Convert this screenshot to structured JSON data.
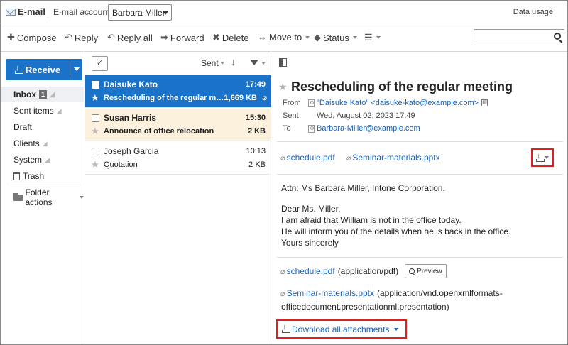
{
  "header": {
    "app_title": "E-mail",
    "account_label": "E-mail account:",
    "account_selected": "Barbara Miller",
    "data_usage": "Data usage"
  },
  "toolbar": {
    "compose": "Compose",
    "reply": "Reply",
    "reply_all": "Reply all",
    "forward": "Forward",
    "delete": "Delete",
    "move_to": "Move to",
    "status": "Status",
    "search_placeholder": ""
  },
  "sidebar": {
    "receive": "Receive",
    "items": [
      {
        "label": "Inbox",
        "badge": "1"
      },
      {
        "label": "Sent items"
      },
      {
        "label": "Draft"
      },
      {
        "label": "Clients"
      },
      {
        "label": "System"
      },
      {
        "label": "Trash"
      }
    ],
    "folder_actions": "Folder actions"
  },
  "list": {
    "sort_label": "Sent",
    "messages": [
      {
        "sender": "Daisuke Kato",
        "time": "17:49",
        "subject": "Rescheduling of the regular me...",
        "size": "1,669 KB",
        "state": "selected"
      },
      {
        "sender": "Susan Harris",
        "time": "15:30",
        "subject": "Announce of office relocation",
        "size": "2 KB",
        "state": "unread"
      },
      {
        "sender": "Joseph Garcia",
        "time": "10:13",
        "subject": "Quotation",
        "size": "2 KB",
        "state": "read"
      }
    ]
  },
  "message": {
    "subject": "Rescheduling of the regular meeting",
    "from_key": "From",
    "from_value": "\"Daisuke Kato\" <daisuke-kato@example.com>",
    "sent_key": "Sent",
    "sent_value": "Wed, August 02, 2023 17:49",
    "to_key": "To",
    "to_value": "Barbara-Miller@example.com",
    "attachments": [
      "schedule.pdf",
      "Seminar-materials.pptx"
    ],
    "body": [
      "Attn: Ms Barbara Miller, Intone Corporation.",
      "Dear Ms. Miller,",
      "I am afraid that William is not in the office today.",
      "He will inform you of the details when he is back in the office.",
      "Yours sincerely"
    ],
    "attachment_details": [
      {
        "name": "schedule.pdf",
        "type": "(application/pdf)",
        "preview": "Preview"
      },
      {
        "name": "Seminar-materials.pptx",
        "type_line1": "(application/vnd.openxmlformats-",
        "type_line2": "officedocument.presentationml.presentation)"
      }
    ],
    "download_all": "Download all attachments"
  },
  "colors": {
    "accent": "#1a73c9",
    "selected_row": "#1a73c9",
    "unread_row": "#fbf1dd",
    "highlight": "#e02020",
    "link": "#1a5fb4"
  }
}
